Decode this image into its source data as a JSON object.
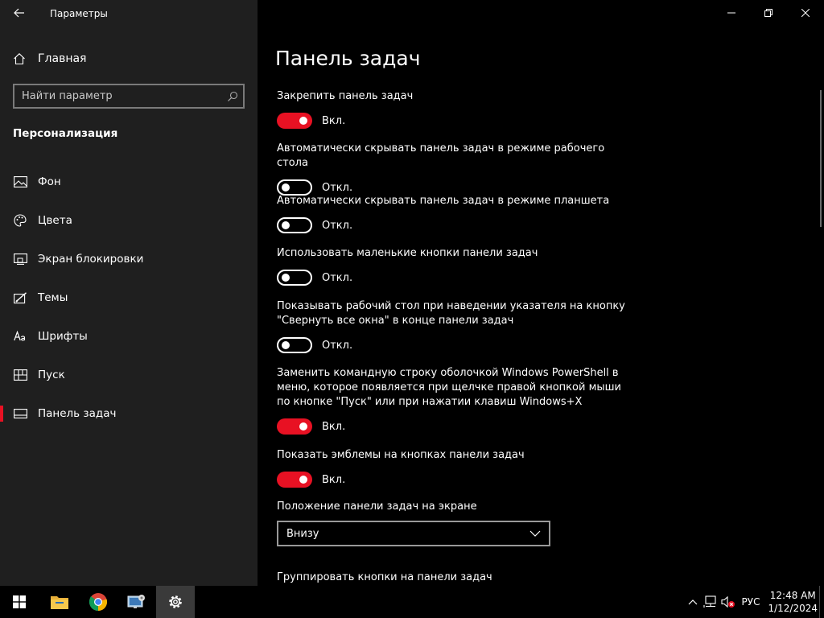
{
  "window": {
    "app_title": "Параметры"
  },
  "sidebar": {
    "home_label": "Главная",
    "search_placeholder": "Найти параметр",
    "section_title": "Персонализация",
    "items": [
      {
        "label": "Фон",
        "icon": "picture-icon"
      },
      {
        "label": "Цвета",
        "icon": "palette-icon"
      },
      {
        "label": "Экран блокировки",
        "icon": "lock-screen-icon"
      },
      {
        "label": "Темы",
        "icon": "themes-icon"
      },
      {
        "label": "Шрифты",
        "icon": "fonts-icon"
      },
      {
        "label": "Пуск",
        "icon": "start-icon"
      },
      {
        "label": "Панель задач",
        "icon": "taskbar-icon",
        "active": true
      }
    ]
  },
  "main": {
    "title": "Панель задач",
    "settings": [
      {
        "desc": "Закрепить панель задач",
        "state": "on",
        "state_label": "Вкл."
      },
      {
        "desc": "Автоматически скрывать панель задач в режиме рабочего стола",
        "state": "off",
        "state_label": "Откл."
      },
      {
        "desc": "Автоматически скрывать панель задач в режиме планшета",
        "state": "off",
        "state_label": "Откл."
      },
      {
        "desc": "Использовать маленькие кнопки панели задач",
        "state": "off",
        "state_label": "Откл."
      },
      {
        "desc": "Показывать рабочий стол при наведении указателя на кнопку \"Свернуть все окна\" в конце панели задач",
        "state": "off",
        "state_label": "Откл."
      },
      {
        "desc": "Заменить командную строку оболочкой Windows PowerShell в меню, которое появляется при щелчке правой кнопкой мыши по кнопке \"Пуск\" или при нажатии клавиш Windows+X",
        "state": "on",
        "state_label": "Вкл."
      },
      {
        "desc": "Показать эмблемы на кнопках панели задач",
        "state": "on",
        "state_label": "Вкл."
      }
    ],
    "position_label": "Положение панели задач на экране",
    "position_value": "Внизу",
    "group_label": "Группировать кнопки на панели задач"
  },
  "taskbar": {
    "apps": [
      "start-icon",
      "file-explorer-icon",
      "chrome-icon",
      "control-panel-icon",
      "settings-icon"
    ],
    "language": "РУС",
    "time": "12:48 AM",
    "date": "1/12/2024"
  },
  "colors": {
    "accent": "#e81123",
    "sidebar_bg": "#1f1f1f",
    "main_bg": "#000000"
  }
}
